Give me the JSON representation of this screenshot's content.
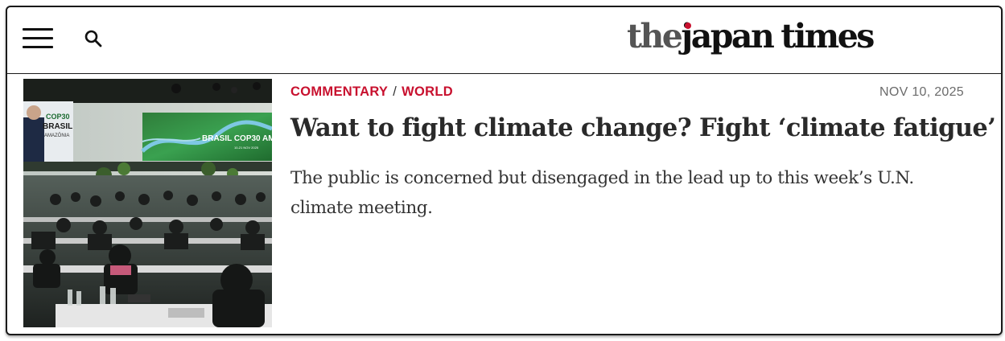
{
  "header": {
    "menu_icon": "hamburger-menu-icon",
    "search_icon": "search-icon",
    "logo": {
      "the": "the",
      "j": "j",
      "rest": "apan",
      "times": "times",
      "text": "the japan times",
      "dot_color": "#c8102e"
    }
  },
  "article": {
    "image": {
      "screen_text_left_1": "COP30",
      "screen_text_left_2": "BRASIL",
      "screen_text_left_3": "AMAZÔNIA",
      "screen_text_right": "BRASIL COP30 AM",
      "screen_text_right_small": "10-21 NOV 2025"
    },
    "kicker": {
      "section": "COMMENTARY",
      "separator": "/",
      "subsection": "WORLD"
    },
    "date": "NOV 10, 2025",
    "headline": "Want to fight climate change? Fight ‘climate fatigue’",
    "dek": "The public is concerned but disengaged in the lead up to this week’s U.N. climate meeting."
  },
  "colors": {
    "accent": "#c8102e",
    "text": "#2a2a2a",
    "muted": "#6b6b6b"
  }
}
